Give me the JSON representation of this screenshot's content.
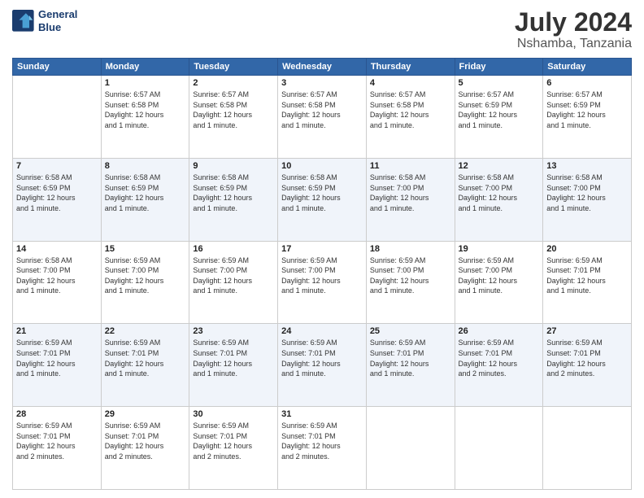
{
  "header": {
    "logo_line1": "General",
    "logo_line2": "Blue",
    "month_year": "July 2024",
    "location": "Nshamba, Tanzania"
  },
  "days_of_week": [
    "Sunday",
    "Monday",
    "Tuesday",
    "Wednesday",
    "Thursday",
    "Friday",
    "Saturday"
  ],
  "weeks": [
    [
      {
        "day": "",
        "info": ""
      },
      {
        "day": "1",
        "info": "Sunrise: 6:57 AM\nSunset: 6:58 PM\nDaylight: 12 hours\nand 1 minute."
      },
      {
        "day": "2",
        "info": "Sunrise: 6:57 AM\nSunset: 6:58 PM\nDaylight: 12 hours\nand 1 minute."
      },
      {
        "day": "3",
        "info": "Sunrise: 6:57 AM\nSunset: 6:58 PM\nDaylight: 12 hours\nand 1 minute."
      },
      {
        "day": "4",
        "info": "Sunrise: 6:57 AM\nSunset: 6:58 PM\nDaylight: 12 hours\nand 1 minute."
      },
      {
        "day": "5",
        "info": "Sunrise: 6:57 AM\nSunset: 6:59 PM\nDaylight: 12 hours\nand 1 minute."
      },
      {
        "day": "6",
        "info": "Sunrise: 6:57 AM\nSunset: 6:59 PM\nDaylight: 12 hours\nand 1 minute."
      }
    ],
    [
      {
        "day": "7",
        "info": "Sunrise: 6:58 AM\nSunset: 6:59 PM\nDaylight: 12 hours\nand 1 minute."
      },
      {
        "day": "8",
        "info": "Sunrise: 6:58 AM\nSunset: 6:59 PM\nDaylight: 12 hours\nand 1 minute."
      },
      {
        "day": "9",
        "info": "Sunrise: 6:58 AM\nSunset: 6:59 PM\nDaylight: 12 hours\nand 1 minute."
      },
      {
        "day": "10",
        "info": "Sunrise: 6:58 AM\nSunset: 6:59 PM\nDaylight: 12 hours\nand 1 minute."
      },
      {
        "day": "11",
        "info": "Sunrise: 6:58 AM\nSunset: 7:00 PM\nDaylight: 12 hours\nand 1 minute."
      },
      {
        "day": "12",
        "info": "Sunrise: 6:58 AM\nSunset: 7:00 PM\nDaylight: 12 hours\nand 1 minute."
      },
      {
        "day": "13",
        "info": "Sunrise: 6:58 AM\nSunset: 7:00 PM\nDaylight: 12 hours\nand 1 minute."
      }
    ],
    [
      {
        "day": "14",
        "info": "Sunrise: 6:58 AM\nSunset: 7:00 PM\nDaylight: 12 hours\nand 1 minute."
      },
      {
        "day": "15",
        "info": "Sunrise: 6:59 AM\nSunset: 7:00 PM\nDaylight: 12 hours\nand 1 minute."
      },
      {
        "day": "16",
        "info": "Sunrise: 6:59 AM\nSunset: 7:00 PM\nDaylight: 12 hours\nand 1 minute."
      },
      {
        "day": "17",
        "info": "Sunrise: 6:59 AM\nSunset: 7:00 PM\nDaylight: 12 hours\nand 1 minute."
      },
      {
        "day": "18",
        "info": "Sunrise: 6:59 AM\nSunset: 7:00 PM\nDaylight: 12 hours\nand 1 minute."
      },
      {
        "day": "19",
        "info": "Sunrise: 6:59 AM\nSunset: 7:00 PM\nDaylight: 12 hours\nand 1 minute."
      },
      {
        "day": "20",
        "info": "Sunrise: 6:59 AM\nSunset: 7:01 PM\nDaylight: 12 hours\nand 1 minute."
      }
    ],
    [
      {
        "day": "21",
        "info": "Sunrise: 6:59 AM\nSunset: 7:01 PM\nDaylight: 12 hours\nand 1 minute."
      },
      {
        "day": "22",
        "info": "Sunrise: 6:59 AM\nSunset: 7:01 PM\nDaylight: 12 hours\nand 1 minute."
      },
      {
        "day": "23",
        "info": "Sunrise: 6:59 AM\nSunset: 7:01 PM\nDaylight: 12 hours\nand 1 minute."
      },
      {
        "day": "24",
        "info": "Sunrise: 6:59 AM\nSunset: 7:01 PM\nDaylight: 12 hours\nand 1 minute."
      },
      {
        "day": "25",
        "info": "Sunrise: 6:59 AM\nSunset: 7:01 PM\nDaylight: 12 hours\nand 1 minute."
      },
      {
        "day": "26",
        "info": "Sunrise: 6:59 AM\nSunset: 7:01 PM\nDaylight: 12 hours\nand 2 minutes."
      },
      {
        "day": "27",
        "info": "Sunrise: 6:59 AM\nSunset: 7:01 PM\nDaylight: 12 hours\nand 2 minutes."
      }
    ],
    [
      {
        "day": "28",
        "info": "Sunrise: 6:59 AM\nSunset: 7:01 PM\nDaylight: 12 hours\nand 2 minutes."
      },
      {
        "day": "29",
        "info": "Sunrise: 6:59 AM\nSunset: 7:01 PM\nDaylight: 12 hours\nand 2 minutes."
      },
      {
        "day": "30",
        "info": "Sunrise: 6:59 AM\nSunset: 7:01 PM\nDaylight: 12 hours\nand 2 minutes."
      },
      {
        "day": "31",
        "info": "Sunrise: 6:59 AM\nSunset: 7:01 PM\nDaylight: 12 hours\nand 2 minutes."
      },
      {
        "day": "",
        "info": ""
      },
      {
        "day": "",
        "info": ""
      },
      {
        "day": "",
        "info": ""
      }
    ]
  ]
}
